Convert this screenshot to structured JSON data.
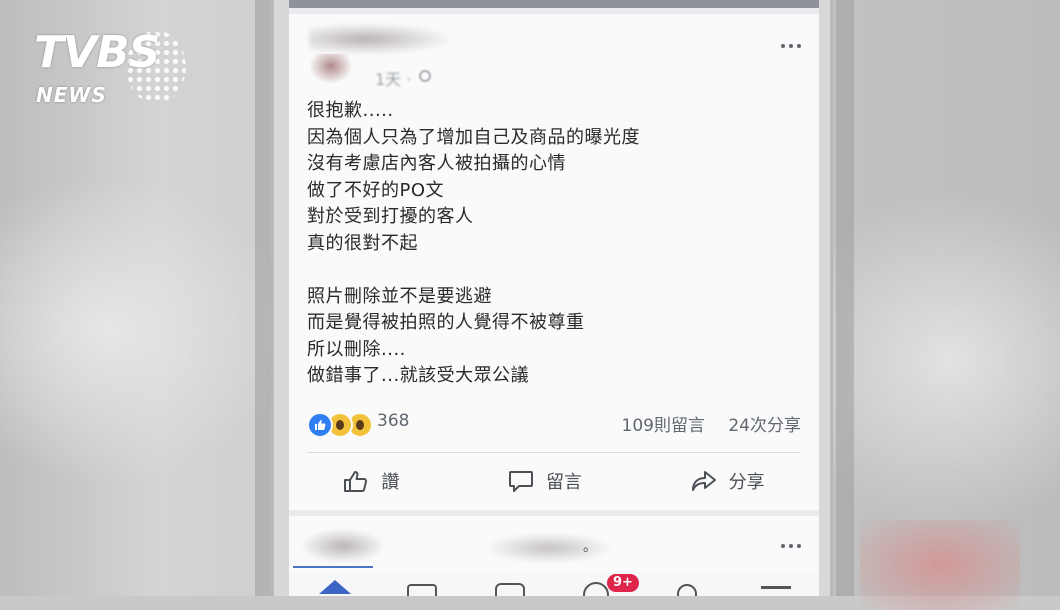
{
  "logo": {
    "brand": "TVBS",
    "sub": "NEWS"
  },
  "post": {
    "time": "1天 ·",
    "lines": [
      "很抱歉.....",
      "因為個人只為了增加自己及商品的曝光度",
      "沒有考慮店內客人被拍攝的心情",
      "做了不好的PO文",
      "對於受到打擾的客人",
      "真的很對不起",
      "",
      "照片刪除並不是要逃避",
      "而是覺得被拍照的人覺得不被尊重",
      "所以刪除....",
      "做錯事了...就該受大眾公議"
    ],
    "reaction_count": "368",
    "comment_count": "109則留言",
    "share_count": "24次分享",
    "actions": {
      "like": "讚",
      "comment": "留言",
      "share": "分享"
    }
  },
  "second_post": {
    "dot": "。"
  },
  "nav": {
    "notification_badge": "9+"
  },
  "colors": {
    "like_blue": "#2f7ef3",
    "wow_yellow": "#f2c23a",
    "badge_red": "#e0254a",
    "nav_active": "#3b64c4"
  }
}
